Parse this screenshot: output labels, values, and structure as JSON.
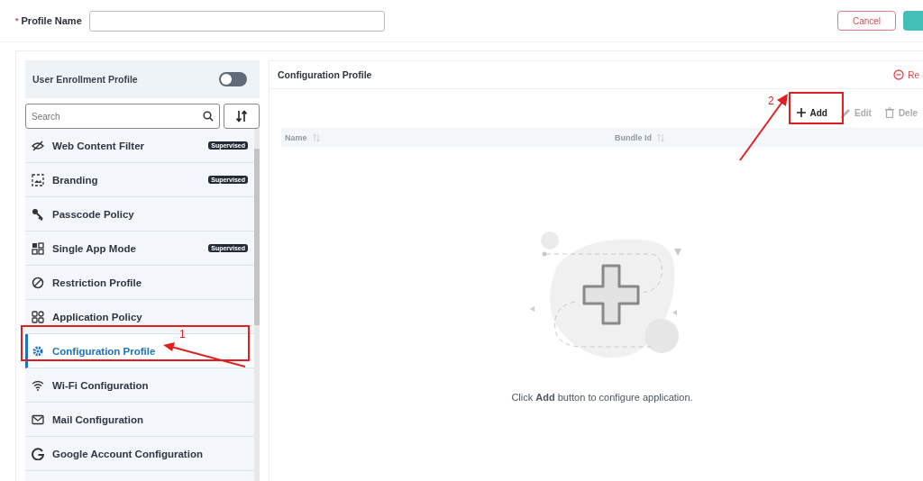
{
  "header": {
    "required_mark": "*",
    "label": "Profile Name",
    "cancel": "Cancel"
  },
  "sidebar": {
    "toggle": {
      "label": "User Enrollment Profile",
      "on": false
    },
    "search": {
      "placeholder": "Search"
    },
    "items": [
      {
        "label": "Web Content Filter",
        "badge": "Supervised",
        "selected": false
      },
      {
        "label": "Branding",
        "badge": "Supervised",
        "selected": false
      },
      {
        "label": "Passcode Policy",
        "selected": false
      },
      {
        "label": "Single App Mode",
        "badge": "Supervised",
        "selected": false
      },
      {
        "label": "Restriction Profile",
        "selected": false
      },
      {
        "label": "Application Policy",
        "selected": false
      },
      {
        "label": "Configuration Profile",
        "selected": true
      },
      {
        "label": "Wi-Fi Configuration",
        "selected": false
      },
      {
        "label": "Mail Configuration",
        "selected": false
      },
      {
        "label": "Google Account Configuration",
        "selected": false
      }
    ]
  },
  "content": {
    "title": "Configuration Profile",
    "remove": "Re",
    "toolbar": [
      {
        "label": "Add",
        "kind": "add",
        "disabled": false
      },
      {
        "label": "Edit",
        "kind": "edit",
        "disabled": true
      },
      {
        "label": "Dele",
        "kind": "delete",
        "disabled": true
      }
    ],
    "columns": [
      "Name",
      "Bundle Id"
    ],
    "empty_message": "Click **Add** button to configure application."
  },
  "annotations": [
    {
      "number": "1"
    },
    {
      "number": "2"
    }
  ]
}
